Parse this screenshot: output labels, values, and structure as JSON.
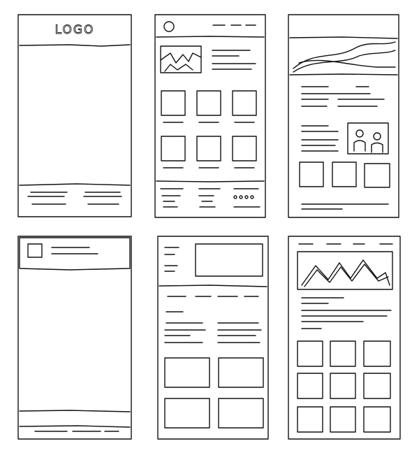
{
  "wireframes": {
    "wf1": {
      "logo_text": "LOGO"
    }
  }
}
